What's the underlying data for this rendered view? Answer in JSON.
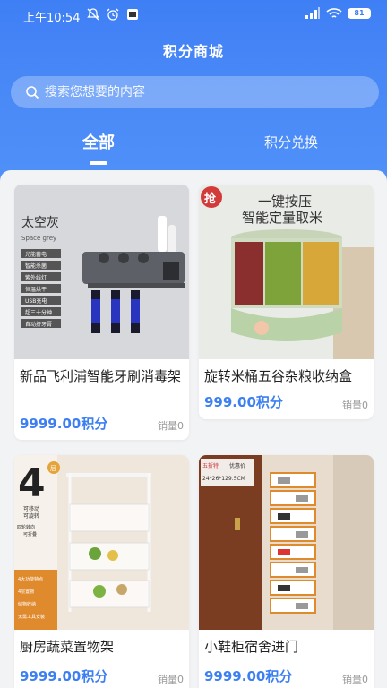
{
  "status": {
    "time": "上午10:54",
    "battery": "81"
  },
  "page_title": "积分商城",
  "search": {
    "placeholder": "搜索您想要的内容"
  },
  "tabs": [
    {
      "label": "全部"
    },
    {
      "label": "积分兑换"
    }
  ],
  "products": [
    {
      "name": "新品飞利浦智能牙刷消毒架",
      "price": "9999.00积分",
      "sales": "销量0",
      "image_text": [
        "太空灰",
        "Space grey",
        "光能蓄电",
        "智能杀菌",
        "紫外线灯",
        "恒温烘干",
        "USB充电",
        "超三十分钟",
        "自动挤牙膏"
      ]
    },
    {
      "name": "旋转米桶五谷杂粮收纳盒",
      "price": "999.00积分",
      "sales": "销量0",
      "image_text": [
        "抢",
        "一键按压",
        "智能定量取米"
      ]
    },
    {
      "name": "厨房蔬菜置物架",
      "price": "9999.00积分",
      "sales": "销量0",
      "image_text": [
        "4",
        "层",
        "可移动",
        "可旋转",
        "四轮转向",
        "可折叠",
        "4大功能特点",
        "4层置物",
        "储物收纳",
        "无需工具安装"
      ]
    },
    {
      "name": "小鞋柜宿舍进门",
      "price": "9999.00积分",
      "sales": "销量0",
      "image_text": [
        "五折特",
        "优惠价",
        "24*26*129.5CM"
      ]
    }
  ],
  "colors": {
    "header_blue": "#3f7ff5",
    "price_blue": "#3b7ff3"
  }
}
